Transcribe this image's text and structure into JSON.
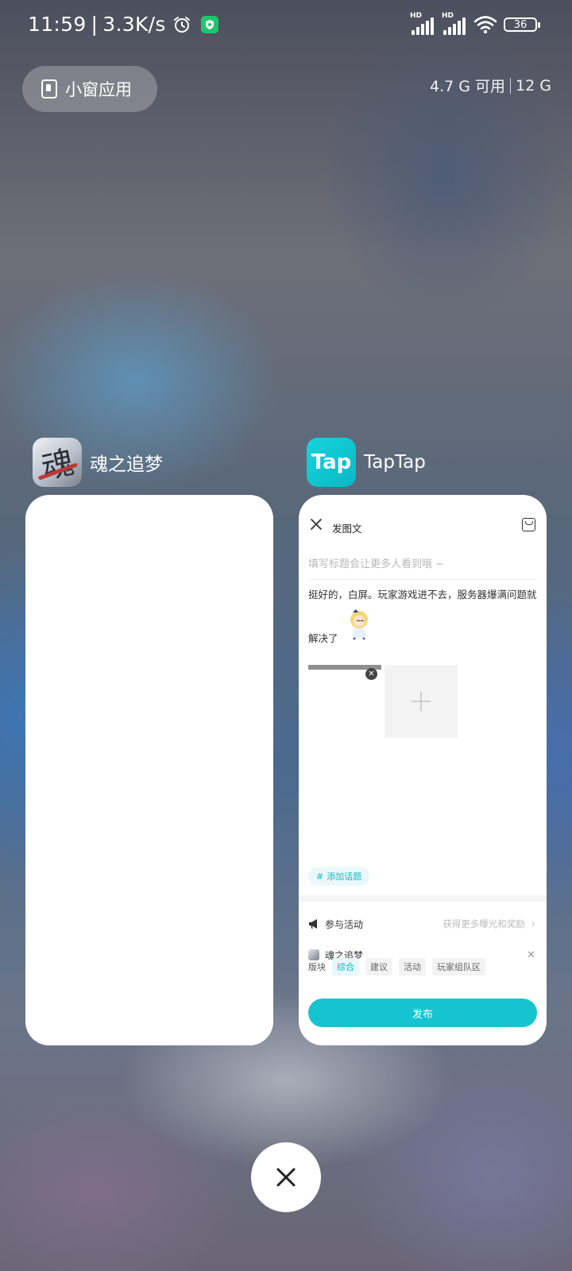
{
  "status_bar": {
    "time": "11:59",
    "separator": "|",
    "speed": "3.3K/s",
    "sim1_badge": "HD",
    "sim2_badge": "HD",
    "battery": "36"
  },
  "top": {
    "window_mode_label": "小窗应用",
    "memory_available": "4.7 G 可用",
    "memory_total": "12 G"
  },
  "apps": [
    {
      "name": "魂之追梦",
      "icon": "hun-game-icon",
      "icon_glyph": "魂"
    },
    {
      "name": "TapTap",
      "icon": "taptap-icon",
      "icon_text": "Tap"
    }
  ],
  "taptap_card": {
    "title": "发图文",
    "title_placeholder": "填写标题会让更多人看到哦 ~",
    "body_line1": "挺好的，白屏。玩家游戏进不去，服务器爆满问题就",
    "body_line2": "解决了",
    "add_topic": "添加话题",
    "topic_hash": "#",
    "activity_label": "参与活动",
    "activity_hint": "获得更多曝光和奖励",
    "game_label": "魂之追梦",
    "board_label": "版块",
    "boards": [
      "综合",
      "建议",
      "活动",
      "玩家组队区"
    ],
    "active_board": "综合",
    "publish_label": "发布"
  },
  "colors": {
    "accent": "#15c4cf",
    "shield": "#1fc66d",
    "card_bg": "#ffffff"
  }
}
